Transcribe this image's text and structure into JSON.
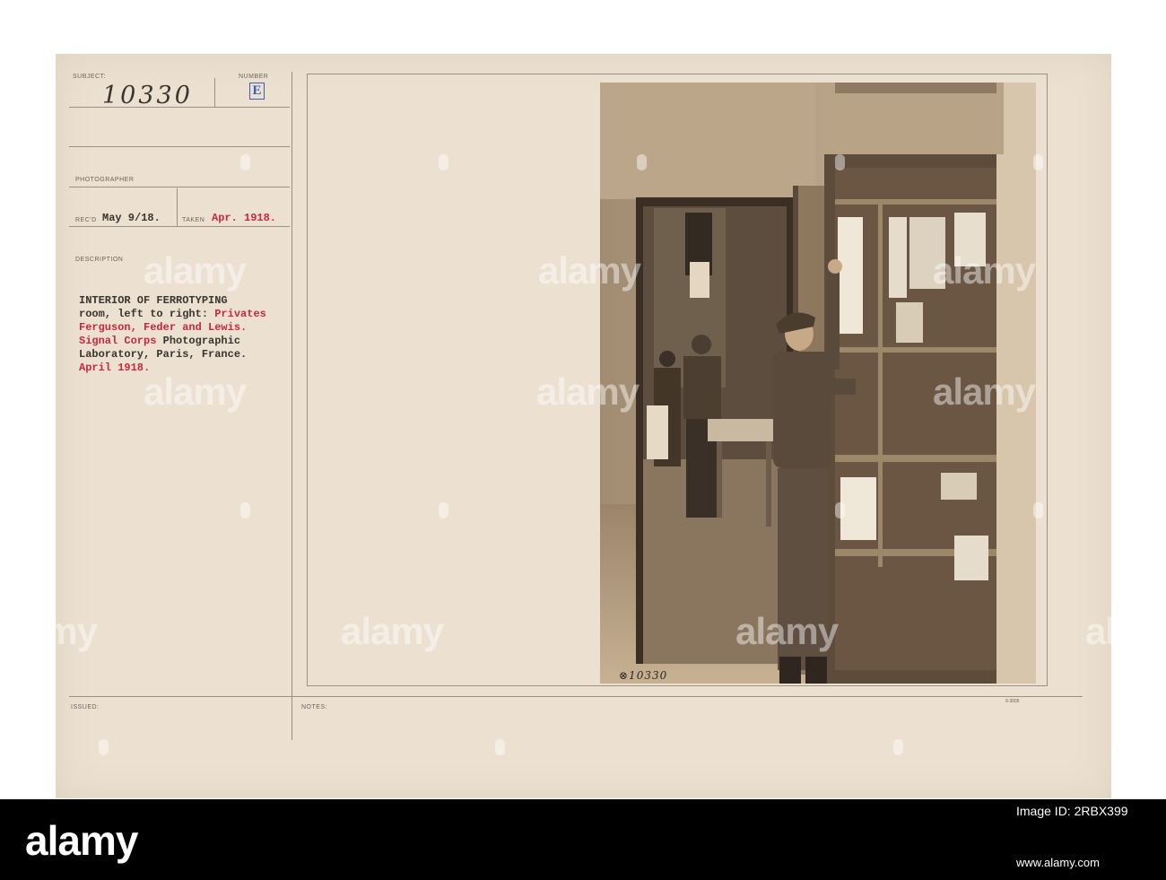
{
  "card": {
    "subject_label": "SUBJECT:",
    "subject_number": "10330",
    "number_label": "NUMBER",
    "number_letter": "E",
    "photographer_label": "PHOTOGRAPHER",
    "recd_label": "REC'D",
    "recd_value": "May 9/18.",
    "taken_label": "TAKEN",
    "taken_value": "Apr. 1918.",
    "description_label": "DESCRIPTION",
    "issued_label": "ISSUED:",
    "notes_label": "NOTES:",
    "photo_caption": "⊗10330",
    "form_code": "9-3005",
    "colors": {
      "card": "#ece1d1",
      "typed_dark": "#3a3530",
      "typed_red": "#c8283c",
      "stamp_blue": "#3d5fb3"
    }
  },
  "description": {
    "l1": "INTERIOR OF FERROTYPING",
    "l2a": "room, left to right: ",
    "l2b": "Privates",
    "l3": "Ferguson, Feder and Lewis.",
    "l4a": "Signal Corps ",
    "l4b": "Photographic",
    "l5": "Laboratory, Paris, France.",
    "l6": "April 1918."
  },
  "watermark": {
    "text": "alamy"
  },
  "footer": {
    "logo": "alamy",
    "image_id": "Image ID: 2RBX399",
    "url": "www.alamy.com"
  }
}
